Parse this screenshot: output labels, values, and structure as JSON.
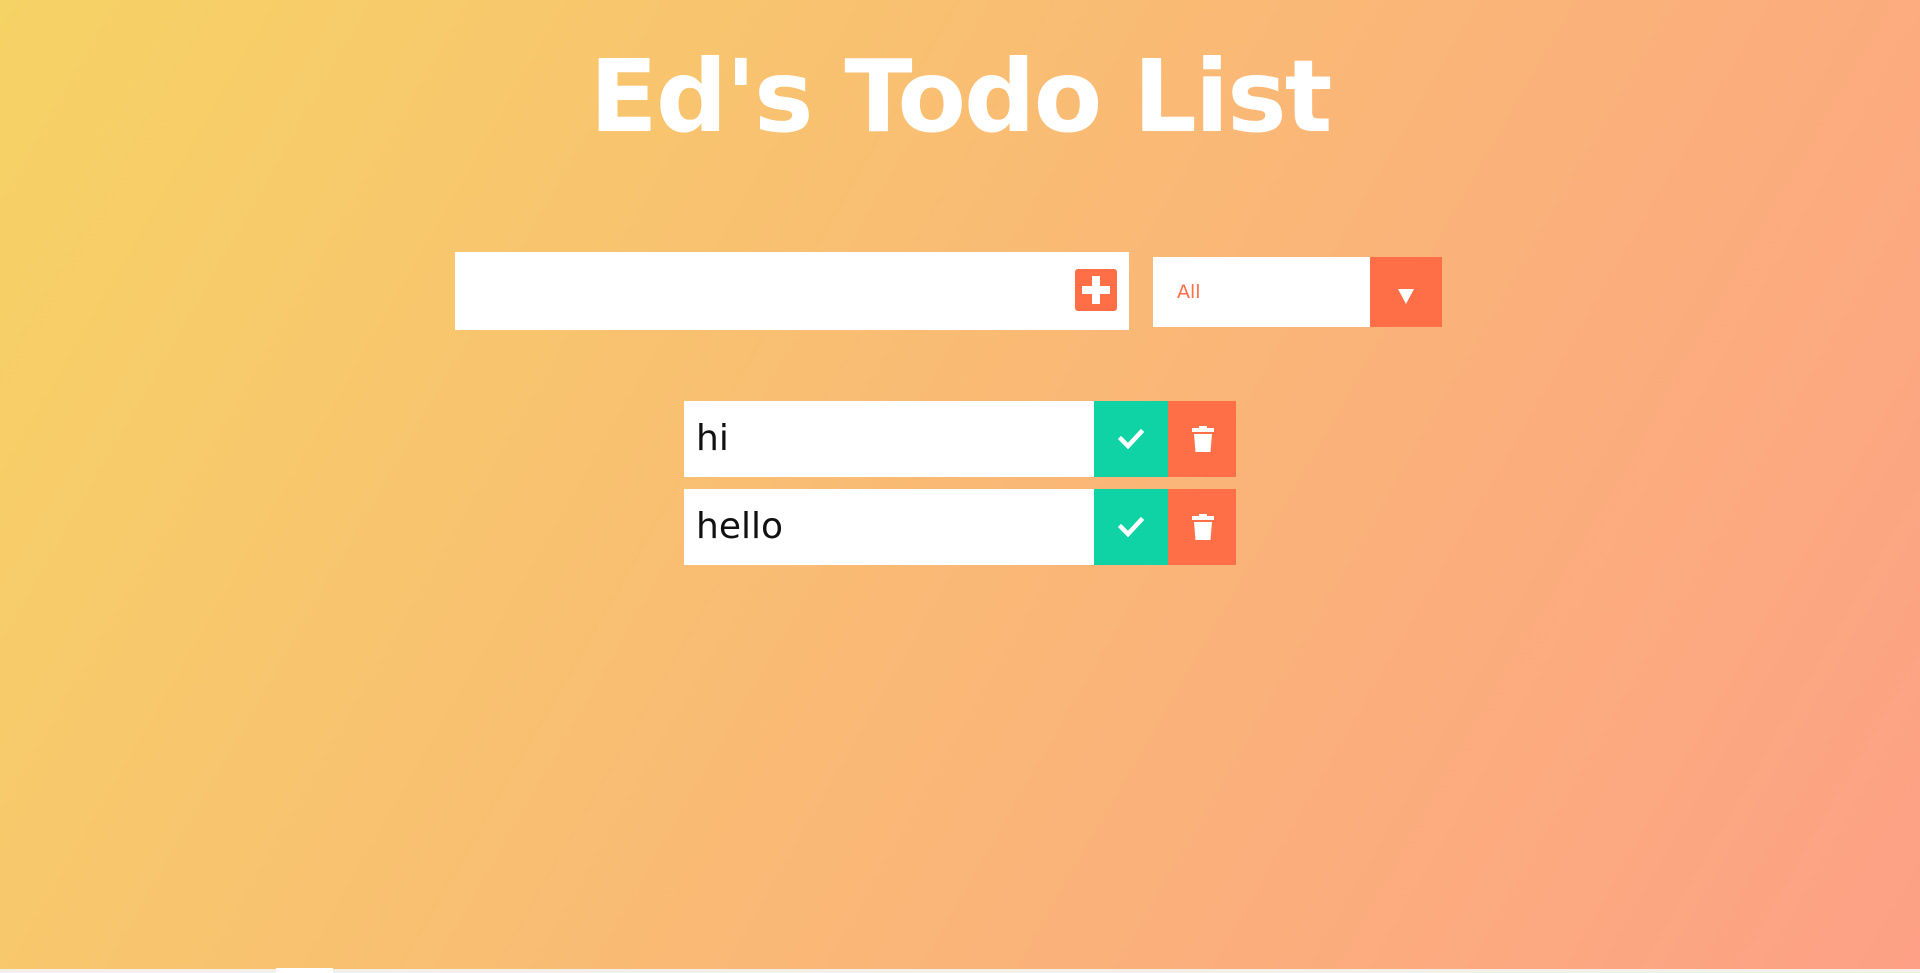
{
  "header": {
    "title": "Ed's Todo List"
  },
  "form": {
    "input_value": "",
    "add_icon": "plus-square-icon",
    "filter": {
      "selected": "All",
      "arrow_icon": "caret-down-icon"
    }
  },
  "todos": [
    {
      "text": "hi",
      "complete_icon": "check-icon",
      "trash_icon": "trash-icon"
    },
    {
      "text": "hello",
      "complete_icon": "check-icon",
      "trash_icon": "trash-icon"
    }
  ],
  "colors": {
    "gradient_start": "#f6d365",
    "gradient_end": "#fda085",
    "accent": "#ff6f47",
    "complete": "#0fd3a5",
    "surface": "#ffffff"
  }
}
